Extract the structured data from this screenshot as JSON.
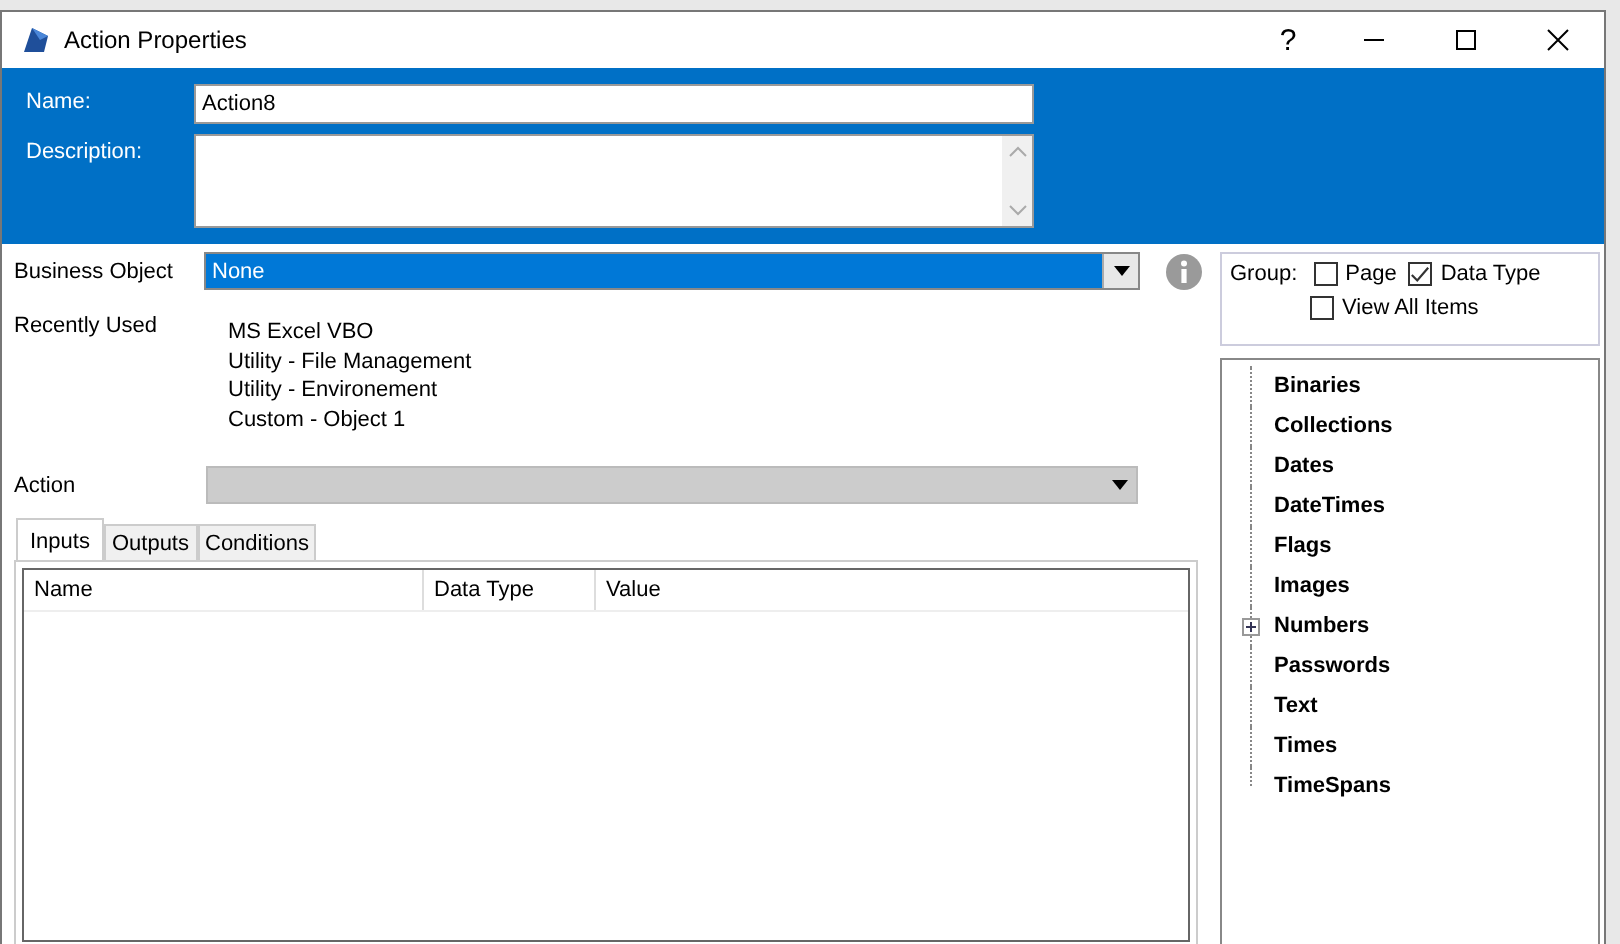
{
  "window": {
    "title": "Action Properties",
    "help": "?"
  },
  "header": {
    "name_label": "Name:",
    "name_value": "Action8",
    "description_label": "Description:"
  },
  "business_object": {
    "label": "Business Object",
    "value": "None"
  },
  "recently_used": {
    "label": "Recently Used",
    "items": [
      "MS Excel VBO",
      "Utility - File Management",
      "Utility - Environement",
      "Custom - Object 1"
    ]
  },
  "action": {
    "label": "Action",
    "disabled": true
  },
  "tabs": [
    {
      "label": "Inputs",
      "selected": true
    },
    {
      "label": "Outputs",
      "selected": false
    },
    {
      "label": "Conditions",
      "selected": false
    }
  ],
  "table": {
    "columns": [
      "Name",
      "Data Type",
      "Value"
    ]
  },
  "group": {
    "label": "Group:",
    "options": [
      {
        "label": "Page",
        "checked": false
      },
      {
        "label": "Data Type",
        "checked": true
      }
    ],
    "view_all": {
      "label": "View All Items",
      "checked": false
    }
  },
  "tree": [
    {
      "label": "Binaries",
      "expandable": false,
      "expanded": false
    },
    {
      "label": "Collections",
      "expandable": false,
      "expanded": false
    },
    {
      "label": "Dates",
      "expandable": false,
      "expanded": false
    },
    {
      "label": "DateTimes",
      "expandable": false,
      "expanded": false
    },
    {
      "label": "Flags",
      "expandable": false,
      "expanded": false
    },
    {
      "label": "Images",
      "expandable": false,
      "expanded": false
    },
    {
      "label": "Numbers",
      "expandable": true,
      "expanded": false
    },
    {
      "label": "Passwords",
      "expandable": false,
      "expanded": false
    },
    {
      "label": "Text",
      "expandable": false,
      "expanded": false
    },
    {
      "label": "Times",
      "expandable": false,
      "expanded": false
    },
    {
      "label": "TimeSpans",
      "expandable": false,
      "expanded": false
    }
  ]
}
